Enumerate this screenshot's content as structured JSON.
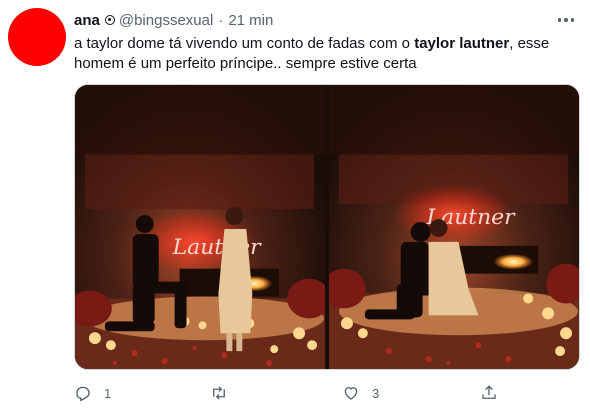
{
  "tweet": {
    "display_name": "ana",
    "handle": "@bingssexual",
    "separator": "·",
    "time": "21 min",
    "text_line1_before": "a taylor dome tá vivendo um conto de fadas com o ",
    "text_bold": "taylor lautner",
    "text_line1_after": ", esse",
    "text_line2": "homem é um perfeito príncipe.. sempre estive certa"
  },
  "avatar": {
    "color": "#ff0000"
  },
  "media": {
    "neon_sign_text": "Lautner",
    "photos": [
      "proposal-photo-1",
      "proposal-photo-2"
    ]
  },
  "actions": {
    "reply_count": "1",
    "retweet_count": "",
    "like_count": "3",
    "icons": [
      "reply-icon",
      "retweet-icon",
      "like-icon",
      "share-icon"
    ]
  },
  "colors": {
    "text_primary": "#0f1419",
    "text_secondary": "#536471",
    "border": "#cfd9de",
    "neon": "#ff3b2f"
  }
}
